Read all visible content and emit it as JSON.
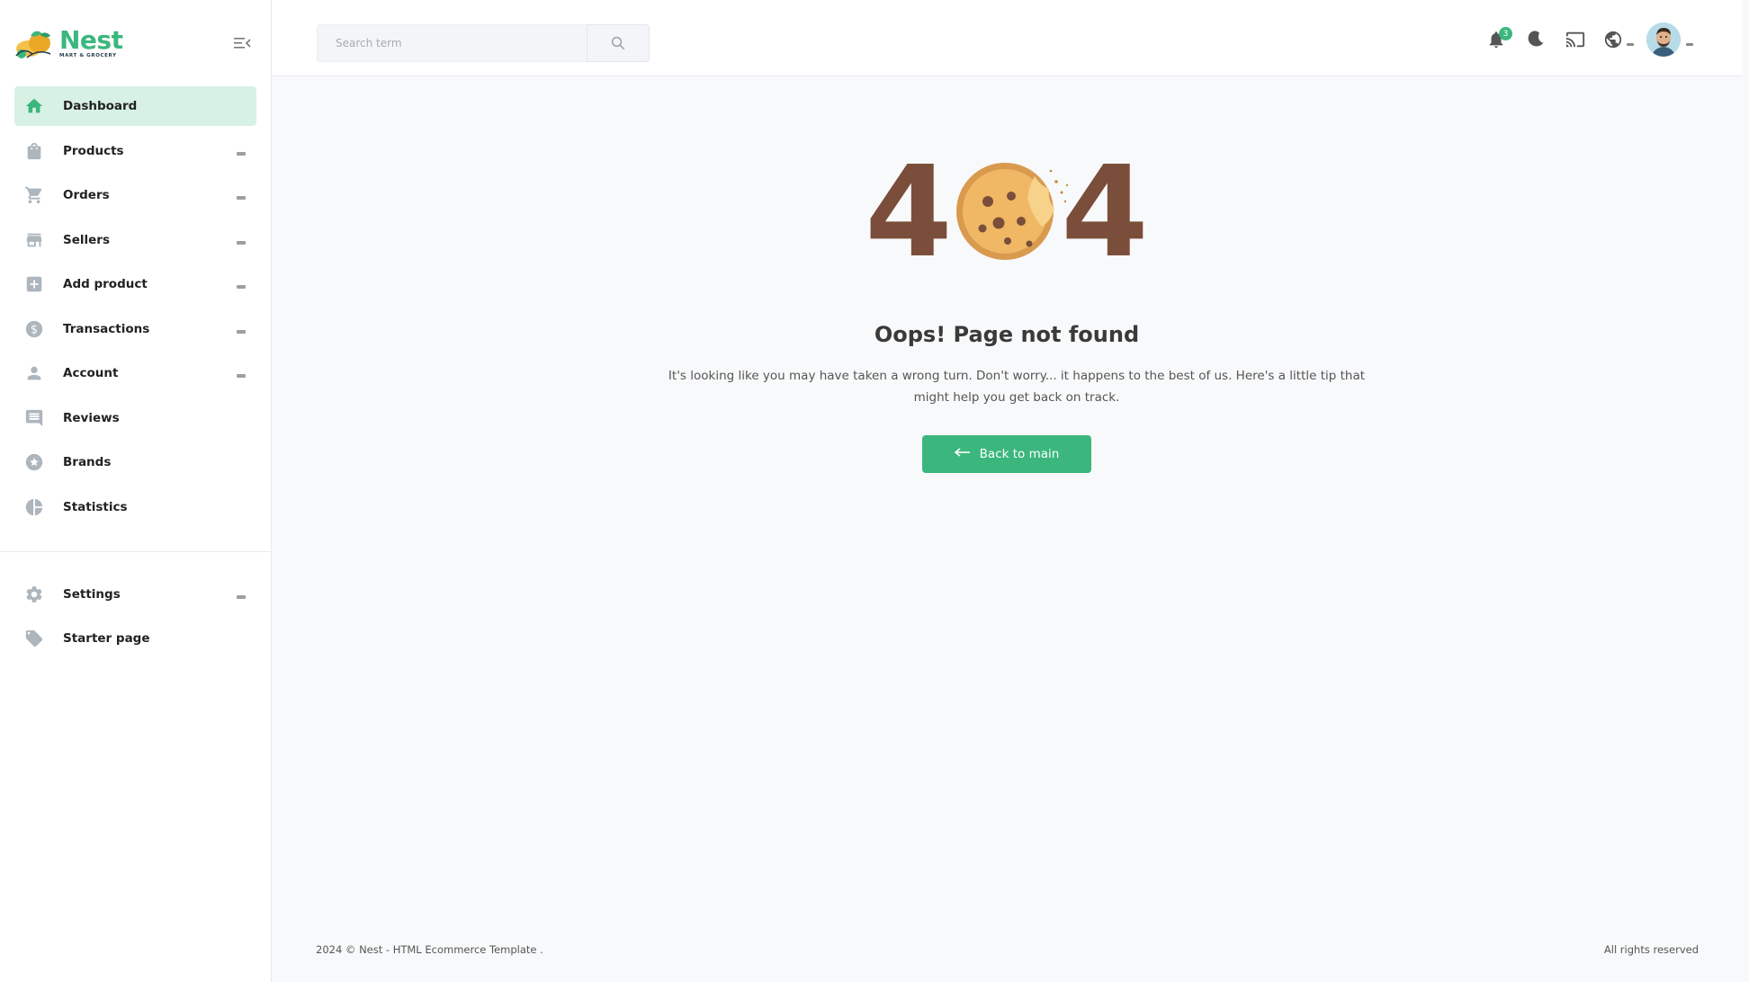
{
  "brand": {
    "name": "Nest",
    "subtitle": "MART & GROCERY"
  },
  "sidebar": {
    "items": [
      {
        "label": "Dashboard",
        "icon": "home-icon",
        "active": true,
        "has_sub": false
      },
      {
        "label": "Products",
        "icon": "shopping-bag-icon",
        "active": false,
        "has_sub": true
      },
      {
        "label": "Orders",
        "icon": "shopping-cart-icon",
        "active": false,
        "has_sub": true
      },
      {
        "label": "Sellers",
        "icon": "store-icon",
        "active": false,
        "has_sub": true
      },
      {
        "label": "Add product",
        "icon": "add-box-icon",
        "active": false,
        "has_sub": true
      },
      {
        "label": "Transactions",
        "icon": "dollar-icon",
        "active": false,
        "has_sub": true
      },
      {
        "label": "Account",
        "icon": "person-icon",
        "active": false,
        "has_sub": true
      },
      {
        "label": "Reviews",
        "icon": "comment-icon",
        "active": false,
        "has_sub": false
      },
      {
        "label": "Brands",
        "icon": "star-icon",
        "active": false,
        "has_sub": false
      },
      {
        "label": "Statistics",
        "icon": "pie-chart-icon",
        "active": false,
        "has_sub": false
      }
    ],
    "bottom_items": [
      {
        "label": "Settings",
        "icon": "settings-icon",
        "has_sub": true
      },
      {
        "label": "Starter page",
        "icon": "tag-icon",
        "has_sub": false
      }
    ]
  },
  "header": {
    "search_placeholder": "Search term",
    "notification_count": "3"
  },
  "error": {
    "code_left": "4",
    "code_right": "4",
    "title": "Oops! Page not found",
    "message": "It's looking like you may have taken a wrong turn. Don't worry... it happens to the best of us. Here's a little tip that might help you get back on track.",
    "button_label": "Back to main"
  },
  "footer": {
    "left": "2024 © Nest - HTML Ecommerce Template .",
    "right": "All rights reserved"
  },
  "colors": {
    "accent": "#3bb77e",
    "active_bg": "#d8f1e5",
    "error_digit": "#7a4e3a"
  }
}
